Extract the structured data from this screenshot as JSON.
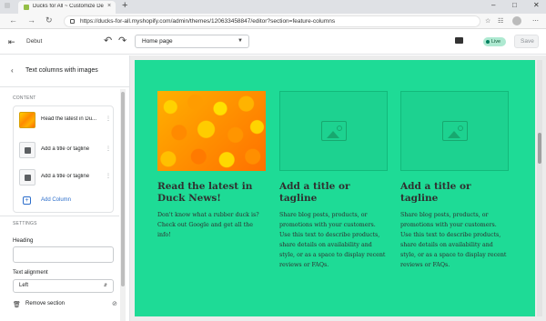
{
  "browser": {
    "tab_title": "Ducks for All ~ Customize Debut",
    "tab_close": "×",
    "new_tab": "+",
    "url": "https://ducks-for-all.myshopify.com/admin/themes/120633458847/editor?section=feature-columns",
    "icons": [
      "back-icon",
      "forward-icon",
      "refresh-icon",
      "lock-icon",
      "star-icon",
      "collections-icon",
      "profile-icon",
      "menu-icon"
    ]
  },
  "editor": {
    "theme_name": "Debut",
    "page_select": "Home page",
    "status": "Live",
    "save_label": "Save"
  },
  "panel": {
    "title": "Text columns with images",
    "content_heading": "CONTENT",
    "blocks": [
      {
        "label": "Read the latest in Du..."
      },
      {
        "label": "Add a title or tagline"
      },
      {
        "label": "Add a title or tagline"
      }
    ],
    "add_column_label": "Add Column",
    "settings_heading": "SETTINGS",
    "heading_label": "Heading",
    "heading_value": "",
    "alignment_label": "Text alignment",
    "alignment_value": "Left",
    "remove_label": "Remove section"
  },
  "preview": {
    "background": "#1edb96",
    "columns": [
      {
        "title": "Read the latest in Duck News!",
        "text": "Don't know what a rubber duck is? Check out Google and get all the info!"
      },
      {
        "title": "Add a title or tagline",
        "text": "Share blog posts, products, or promotions with your customers. Use this text to describe products, share details on availability and style, or as a space to display recent reviews or FAQs."
      },
      {
        "title": "Add a title or tagline",
        "text": "Share blog posts, products, or promotions with your customers. Use this text to describe products, share details on availability and style, or as a space to display recent reviews or FAQs."
      }
    ]
  }
}
